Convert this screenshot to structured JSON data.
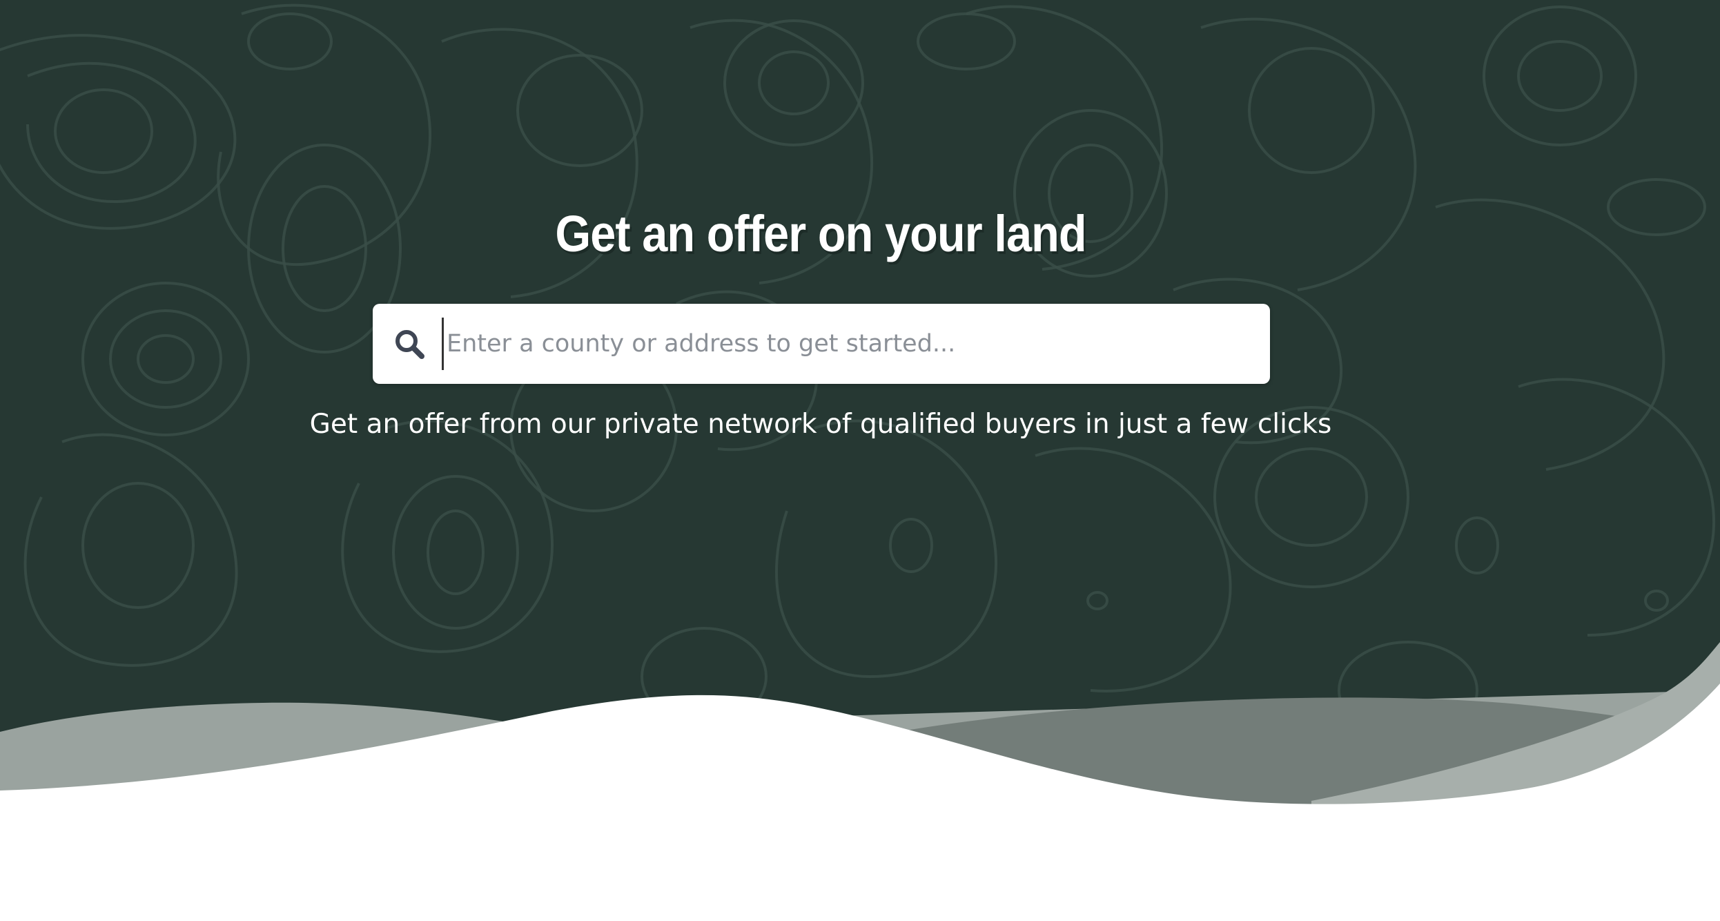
{
  "hero": {
    "title": "Get an offer on your land",
    "subtitle": "Get an offer from our private network of qualified buyers in just a few clicks"
  },
  "search": {
    "placeholder": "Enter a county or address to get started...",
    "value": "",
    "icon": "search-icon"
  },
  "colors": {
    "hero_background": "#263833",
    "contour_lines": "#3a4d48",
    "wave_light": "#9aa39f",
    "wave_mid": "#737d79",
    "page_background": "#ffffff",
    "search_icon": "#3f4654"
  }
}
